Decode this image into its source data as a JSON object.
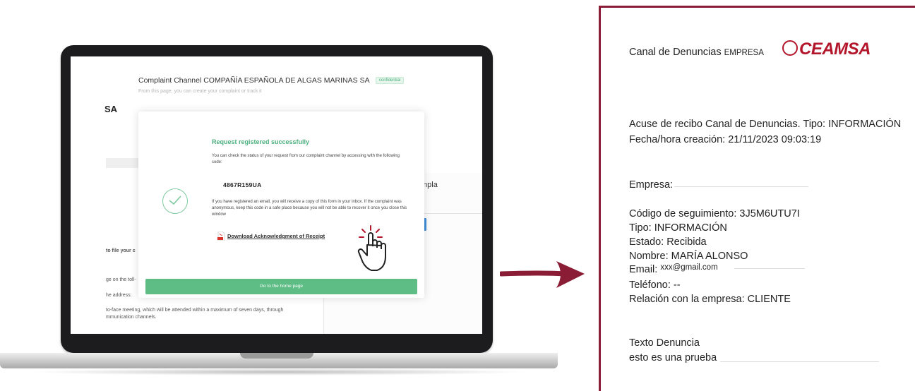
{
  "laptop": {
    "header_title": "Complaint Channel COMPAÑÍA ESPAÑOLA DE ALGAS MARINAS SA",
    "badge": "confidential",
    "subtitle": "From this page, you can create your complaint or track it",
    "logo_fragment": "SA",
    "right_panel_fragment": "mpla",
    "background_lines": [
      "to file your c",
      "ge on the toll-",
      "he address:",
      "to-face meeting, which will be attended within a maximum of seven days, through",
      "mmunication channels."
    ],
    "modal": {
      "title": "Request registered successfully",
      "intro": "You can check the status of your request from our complaint channel by accessing with the following code:",
      "code": "4867R159UA",
      "notice": "If you have registered an email, you will receive a copy of this form in your inbox. If the complaint was anonymous, keep this code in a safe place because you will not be able to recover it once you close this window",
      "download_label": "Download Acknowledgment of Receipt",
      "home_button": "Go to the home page"
    }
  },
  "document": {
    "channel_label": "Canal de Denuncias",
    "company_label": "EMPRESA",
    "brand_logo": "CEAMSA",
    "ack_line": "Acuse de recibo Canal de Denuncias. Tipo: INFORMACIÓN",
    "date_line": "Fecha/hora creación: 21/11/2023 09:03:19",
    "empresa_line": "Empresa:",
    "tracking_line": "Código de seguimiento: 3J5M6UTU7I",
    "tipo_line": "Tipo: INFORMACIÓN",
    "estado_line": "Estado: Recibida",
    "nombre_line": "Nombre: MARÍA ALONSO",
    "email_label": "Email:",
    "email_value": "xxx@gmail.com",
    "telefono_line": "Teléfono: --",
    "relacion_line": "Relación con la empresa: CLIENTE",
    "texto_label": "Texto Denuncia",
    "texto_value": "esto es una prueba"
  },
  "colors": {
    "accent_green": "#5ebd85",
    "brand_red": "#b3152b",
    "frame_maroon": "#8a1d35",
    "arrow": "#8a1d35"
  }
}
